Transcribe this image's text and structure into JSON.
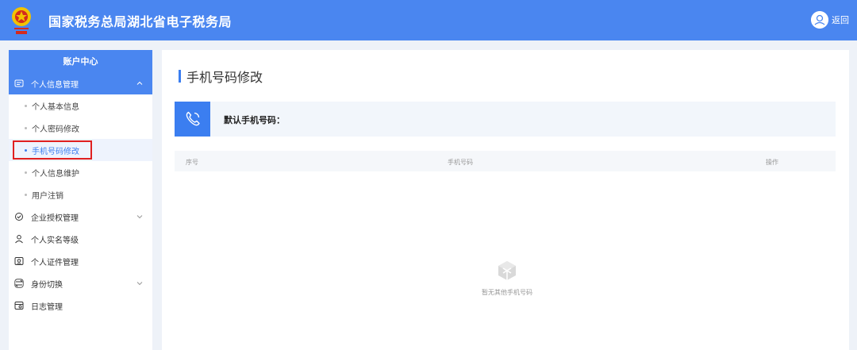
{
  "header": {
    "title": "国家税务总局湖北省电子税务局",
    "return_label": "返回"
  },
  "sidebar": {
    "title": "账户中心",
    "groups": [
      {
        "label": "个人信息管理",
        "icon": "profile-card-icon",
        "expanded": true,
        "items": [
          {
            "label": "个人基本信息"
          },
          {
            "label": "个人密码修改"
          },
          {
            "label": "手机号码修改",
            "active": true
          },
          {
            "label": "个人信息维护"
          },
          {
            "label": "用户注销"
          }
        ]
      },
      {
        "label": "企业授权管理",
        "icon": "shield-check-icon",
        "expanded": false
      },
      {
        "label": "个人实名等级",
        "icon": "user-level-icon"
      },
      {
        "label": "个人证件管理",
        "icon": "id-card-icon"
      },
      {
        "label": "身份切换",
        "icon": "switch-icon",
        "expanded": false
      },
      {
        "label": "日志管理",
        "icon": "log-icon"
      }
    ]
  },
  "main": {
    "page_title": "手机号码修改",
    "default_phone_label": "默认手机号码：",
    "table": {
      "columns": [
        "序号",
        "手机号码",
        "操作"
      ]
    },
    "empty_text": "暂无其他手机号码"
  },
  "colors": {
    "primary": "#4a86f0",
    "accent": "#3b7ef0",
    "highlight_border": "#e02020"
  }
}
